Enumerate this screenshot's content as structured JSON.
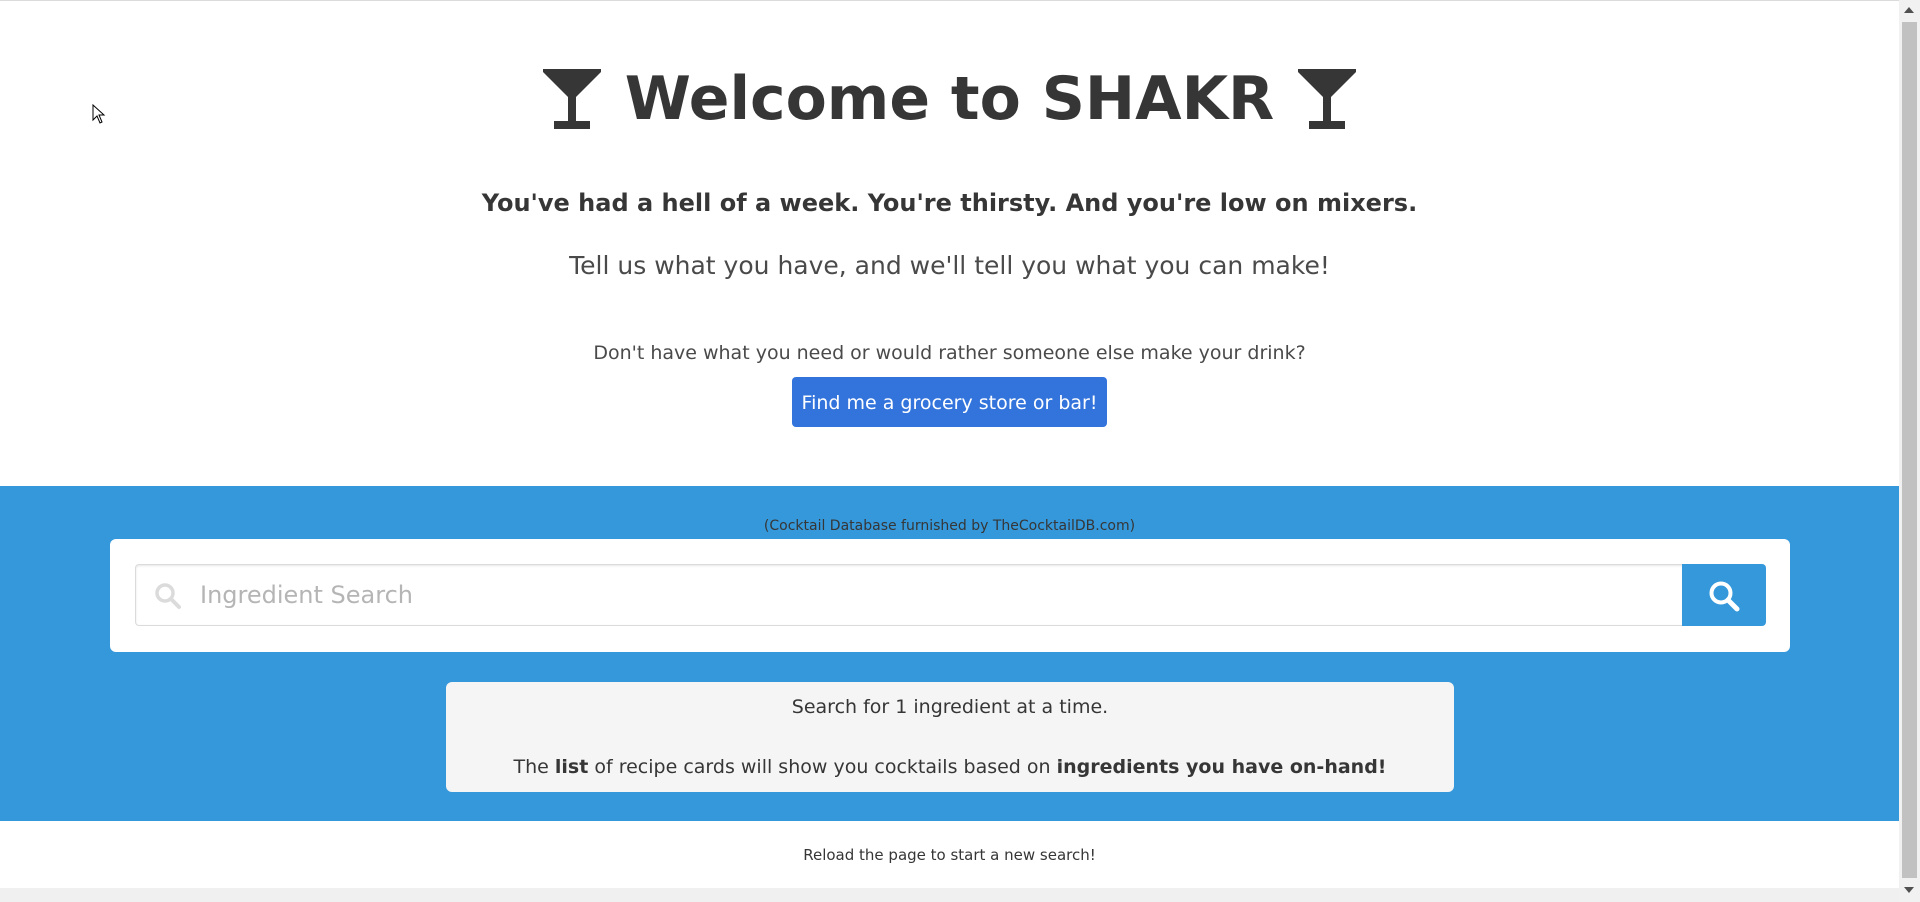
{
  "hero": {
    "title": "Welcome to SHAKR",
    "subtitle": "You've had a hell of a week. You're thirsty. And you're low on mixers.",
    "tagline": "Tell us what you have, and we'll tell you what you can make!",
    "question": "Don't have what you need or would rather someone else make your drink?",
    "find_button_label": "Find me a grocery store or bar!",
    "title_icon": "cocktail-glass-icon"
  },
  "search": {
    "credit": "(Cocktail Database furnished by TheCocktailDB.com)",
    "placeholder": "Ingredient Search",
    "value": "",
    "input_icon": "search-icon",
    "button_icon": "search-icon"
  },
  "notice": {
    "line1": "Search for 1 ingredient at a time.",
    "line2_part1": "The ",
    "line2_bold1": "list",
    "line2_part2": " of recipe cards will show you cocktails based on ",
    "line2_bold2": "ingredients you have on-hand!"
  },
  "footer": {
    "note": "Reload the page to start a new search!"
  },
  "colors": {
    "primary_button": "#3273dc",
    "band_blue": "#3498db",
    "notice_bg": "#f5f5f5",
    "text": "#363636"
  }
}
